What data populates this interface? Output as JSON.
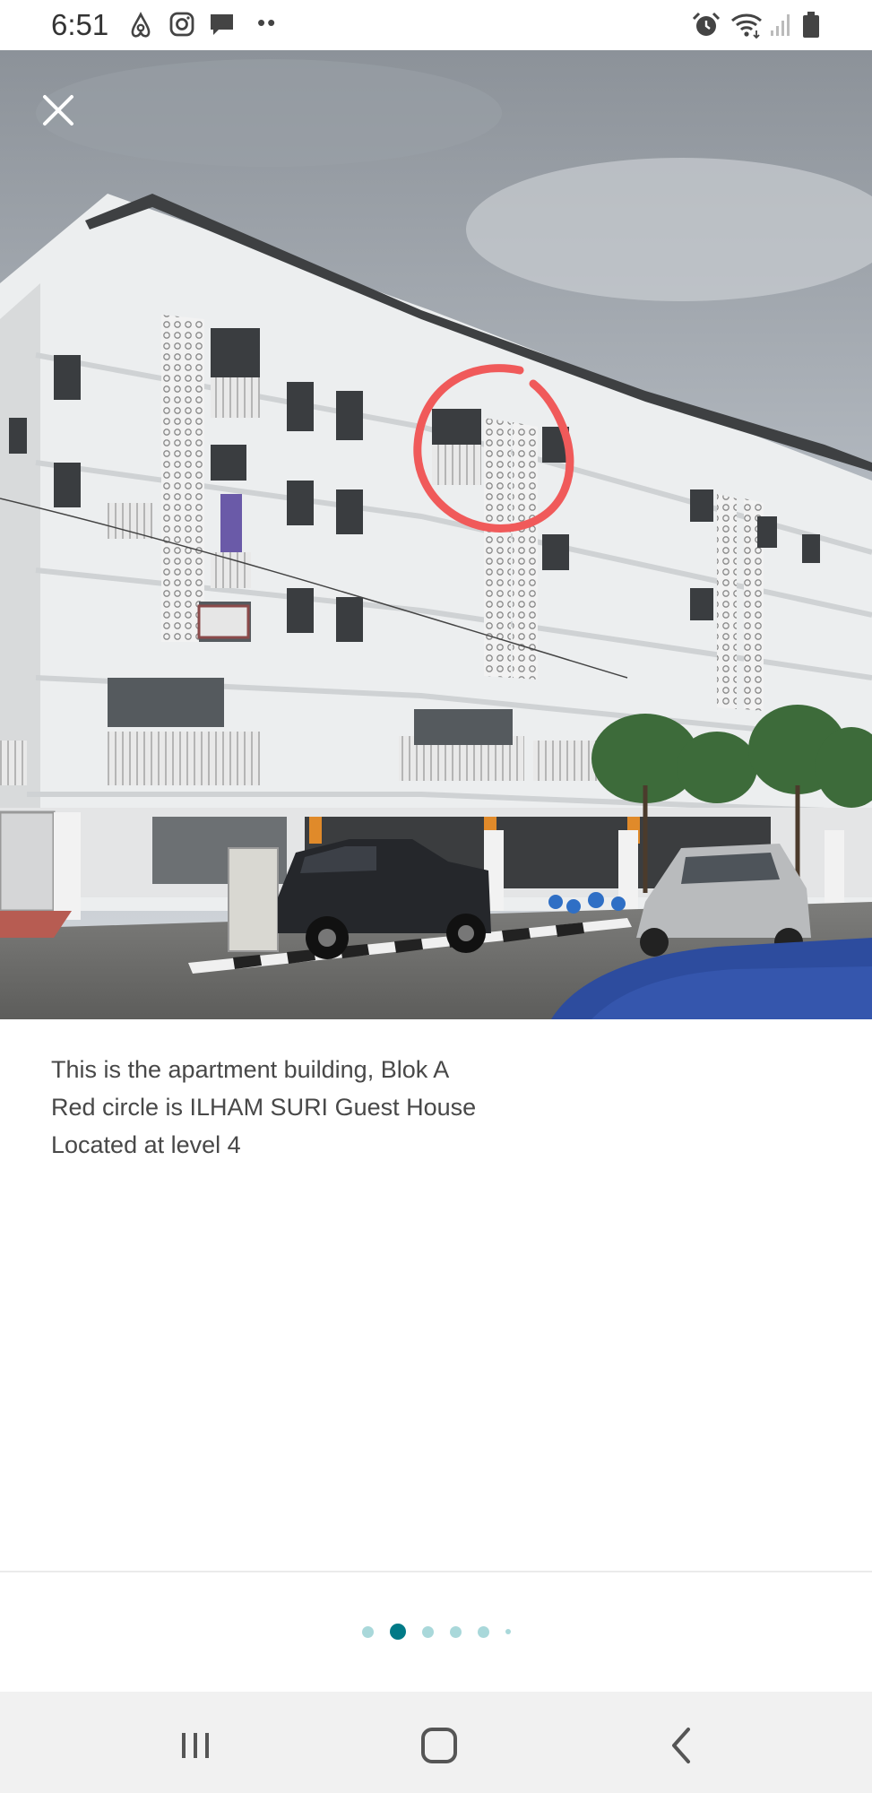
{
  "status_bar": {
    "time": "6:51",
    "left_icons": [
      "airbnb-icon",
      "instagram-icon",
      "message-icon"
    ],
    "overflow_dots": "••",
    "right_icons": [
      "alarm-icon",
      "wifi-icon",
      "signal-icon",
      "battery-icon"
    ]
  },
  "photo": {
    "description_icon": "apartment-photo",
    "annotation_color": "#f05a5a",
    "close_icon": "close-icon"
  },
  "caption": {
    "line1": "This is the apartment building, Blok A",
    "line2": "Red circle is ILHAM SURI Guest House",
    "line3": "Located at level 4"
  },
  "pager": {
    "total": 6,
    "active_index": 1,
    "active_color": "#007a87",
    "inactive_color": "#a9d8da"
  },
  "nav_bar": {
    "buttons": [
      "recent-apps-icon",
      "home-icon",
      "back-icon"
    ]
  }
}
